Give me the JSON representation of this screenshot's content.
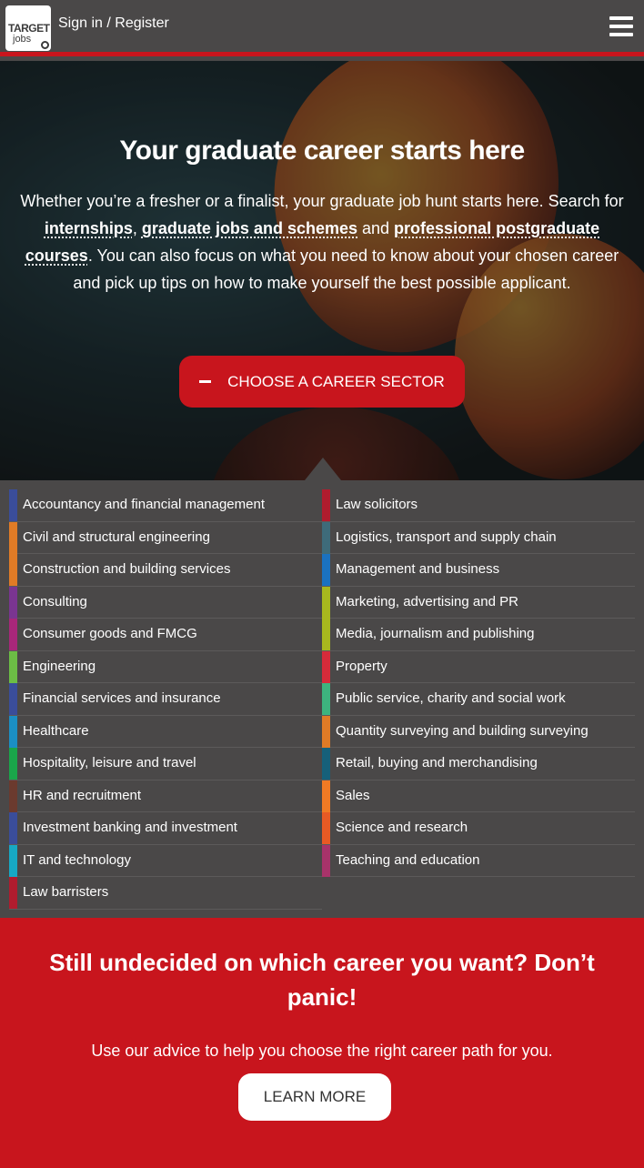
{
  "header": {
    "logo_line1": "TARGET",
    "logo_line2": "jobs",
    "signin_label": "Sign in / Register",
    "menu_icon": "hamburger-menu-icon"
  },
  "hero": {
    "title": "Your graduate career starts here",
    "text_1": "Whether you’re a fresher or a finalist, your graduate job hunt starts here. Search for ",
    "link_internships": "internships",
    "text_2": ", ",
    "link_graduate_jobs": "graduate jobs and schemes",
    "text_3": " and ",
    "link_postgraduate": "professional postgraduate courses",
    "text_4": ". You can also focus on what you need to know about your chosen career and pick up tips on how to make yourself the best possible applicant.",
    "sector_button_label": "CHOOSE A CAREER SECTOR"
  },
  "sectors": {
    "left": [
      {
        "label": "Accountancy and financial management",
        "color": "#3a4d9a"
      },
      {
        "label": "Civil and structural engineering",
        "color": "#e07b26"
      },
      {
        "label": "Construction and building services",
        "color": "#e07b26"
      },
      {
        "label": "Consulting",
        "color": "#7a3591"
      },
      {
        "label": "Consumer goods and FMCG",
        "color": "#a8277a"
      },
      {
        "label": "Engineering",
        "color": "#6cbd45"
      },
      {
        "label": "Financial services and insurance",
        "color": "#3a4d9a"
      },
      {
        "label": "Healthcare",
        "color": "#1b8fc4"
      },
      {
        "label": "Hospitality, leisure and travel",
        "color": "#1aa54a"
      },
      {
        "label": "HR and recruitment",
        "color": "#6b3a2e"
      },
      {
        "label": "Investment banking and investment",
        "color": "#3a4d9a"
      },
      {
        "label": "IT and technology",
        "color": "#17a8c4"
      },
      {
        "label": "Law barristers",
        "color": "#b01c2e"
      }
    ],
    "right": [
      {
        "label": "Law solicitors",
        "color": "#b01c2e"
      },
      {
        "label": "Logistics, transport and supply chain",
        "color": "#3e6b7a"
      },
      {
        "label": "Management and business",
        "color": "#1a72c0"
      },
      {
        "label": "Marketing, advertising and PR",
        "color": "#a8b81e"
      },
      {
        "label": "Media, journalism and publishing",
        "color": "#a8b81e"
      },
      {
        "label": "Property",
        "color": "#d62b3a"
      },
      {
        "label": "Public service, charity and social work",
        "color": "#3db37e"
      },
      {
        "label": "Quantity surveying and building surveying",
        "color": "#e07b26"
      },
      {
        "label": "Retail, buying and merchandising",
        "color": "#16607a"
      },
      {
        "label": "Sales",
        "color": "#f07a24"
      },
      {
        "label": "Science and research",
        "color": "#e85a24"
      },
      {
        "label": "Teaching and education",
        "color": "#a8336a"
      }
    ]
  },
  "cta": {
    "title": "Still undecided on which career you want? Don’t panic!",
    "text": "Use our advice to help you choose the right career path for you.",
    "button_label": "LEARN MORE"
  },
  "colors": {
    "brand_red": "#c8151d",
    "panel_grey": "#4a4848"
  }
}
